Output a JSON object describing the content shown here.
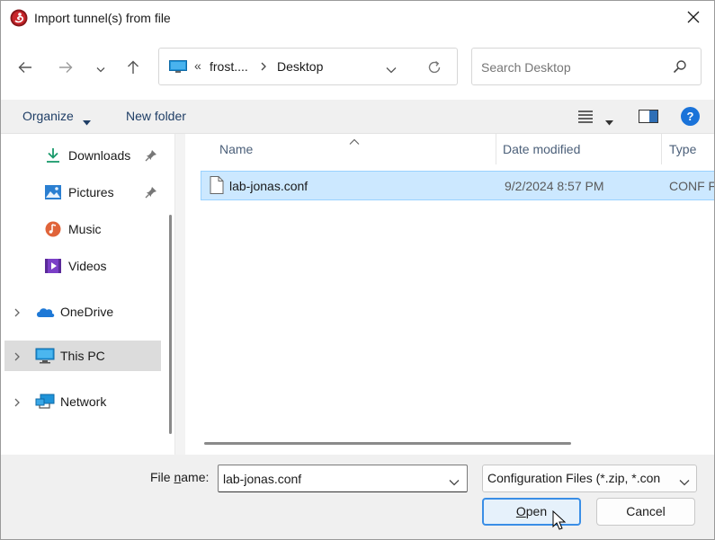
{
  "window": {
    "title": "Import tunnel(s) from file",
    "icon": "wireguard-app-icon",
    "close_icon": "close-icon"
  },
  "nav": {
    "back_icon": "arrow-left-icon",
    "forward_icon": "arrow-right-icon",
    "recent_icon": "chevron-down-icon",
    "up_icon": "arrow-up-icon"
  },
  "address": {
    "overflow": "«",
    "segment1": "frost....",
    "separator": "›",
    "segment2": "Desktop"
  },
  "search": {
    "placeholder": "Search Desktop"
  },
  "toolbar": {
    "organize_label": "Organize",
    "new_folder_label": "New folder"
  },
  "sidebar": {
    "items": [
      {
        "label": "Downloads",
        "icon": "download-icon",
        "pinned": true
      },
      {
        "label": "Pictures",
        "icon": "pictures-icon",
        "pinned": true
      },
      {
        "label": "Music",
        "icon": "music-icon",
        "pinned": false
      },
      {
        "label": "Videos",
        "icon": "videos-icon",
        "pinned": false
      },
      {
        "label": "OneDrive",
        "icon": "cloud-icon",
        "expandable": true
      },
      {
        "label": "This PC",
        "icon": "computer-icon",
        "expandable": true,
        "selected": true
      },
      {
        "label": "Network",
        "icon": "network-icon",
        "expandable": true
      }
    ]
  },
  "files": {
    "columns": {
      "name": "Name",
      "date": "Date modified",
      "type": "Type"
    },
    "rows": [
      {
        "name": "lab-jonas.conf",
        "date": "9/2/2024 8:57 PM",
        "type": "CONF F",
        "selected": true
      }
    ]
  },
  "bottom": {
    "file_name_prefix": "File ",
    "file_name_underlined": "n",
    "file_name_suffix": "ame:",
    "file_name_value": "lab-jonas.conf",
    "file_type_value": "Configuration Files (*.zip, *.con",
    "open_underlined": "O",
    "open_rest": "pen",
    "cancel_label": "Cancel"
  },
  "colors": {
    "accent": "#3a8ee6",
    "selection": "#cce8ff",
    "help": "#1a73d9"
  }
}
